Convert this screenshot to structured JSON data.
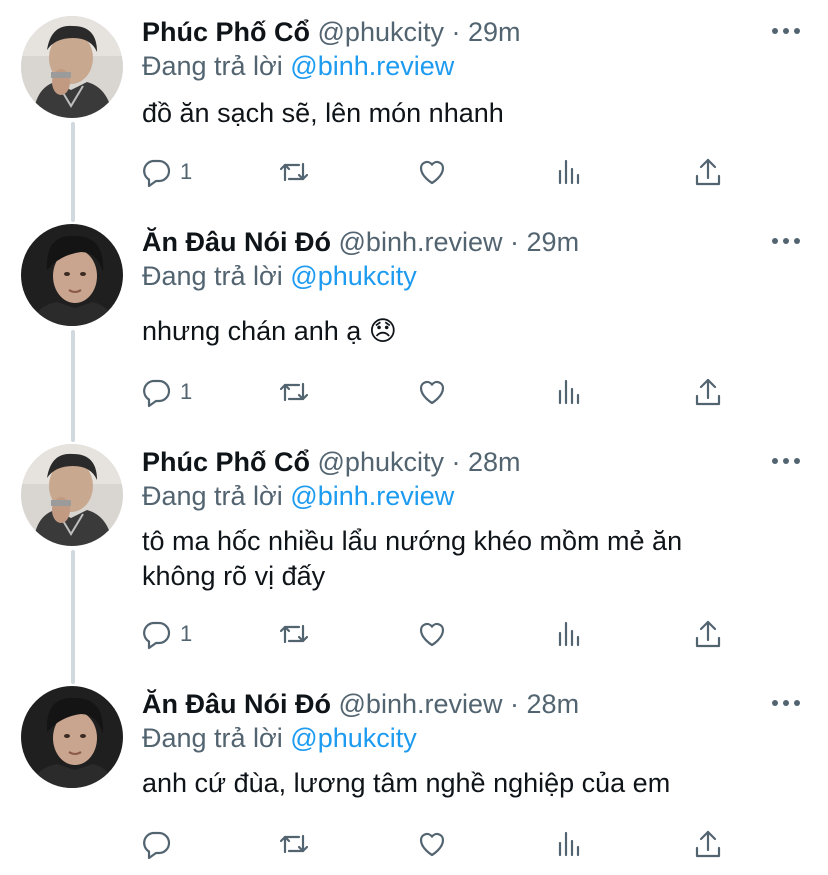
{
  "colors": {
    "accent": "#1d9bf0",
    "muted": "#536471",
    "text": "#0f1419",
    "thread_line": "#cfd9de"
  },
  "tweets": [
    {
      "author": {
        "name": "Phúc Phố Cổ",
        "handle": "@phukcity",
        "avatar": "avatar-phuc"
      },
      "time": "29m",
      "separator": "·",
      "reply_prefix": "Đang trả lời",
      "reply_to": "@binh.review",
      "text": "đồ ăn sạch sẽ, lên món nhanh",
      "reply_count": "1"
    },
    {
      "author": {
        "name": "Ăn Đâu Nói Đó",
        "handle": "@binh.review",
        "avatar": "avatar-binh"
      },
      "time": "29m",
      "separator": "·",
      "reply_prefix": "Đang trả lời",
      "reply_to": "@phukcity",
      "text": "nhưng chán anh ạ 😞",
      "reply_count": "1"
    },
    {
      "author": {
        "name": "Phúc Phố Cổ",
        "handle": "@phukcity",
        "avatar": "avatar-phuc"
      },
      "time": "28m",
      "separator": "·",
      "reply_prefix": "Đang trả lời",
      "reply_to": "@binh.review",
      "text": "tô ma hốc nhiều lẩu nướng khéo mồm mẻ ăn không rõ vị đấy",
      "reply_count": "1"
    },
    {
      "author": {
        "name": "Ăn Đâu Nói Đó",
        "handle": "@binh.review",
        "avatar": "avatar-binh"
      },
      "time": "28m",
      "separator": "·",
      "reply_prefix": "Đang trả lời",
      "reply_to": "@phukcity",
      "text": "anh cứ đùa, lương tâm nghề nghiệp của em",
      "reply_count": ""
    }
  ],
  "icons": {
    "reply": "reply-icon",
    "retweet": "retweet-icon",
    "like": "heart-icon",
    "views": "analytics-icon",
    "share": "share-icon",
    "more": "more-icon"
  }
}
